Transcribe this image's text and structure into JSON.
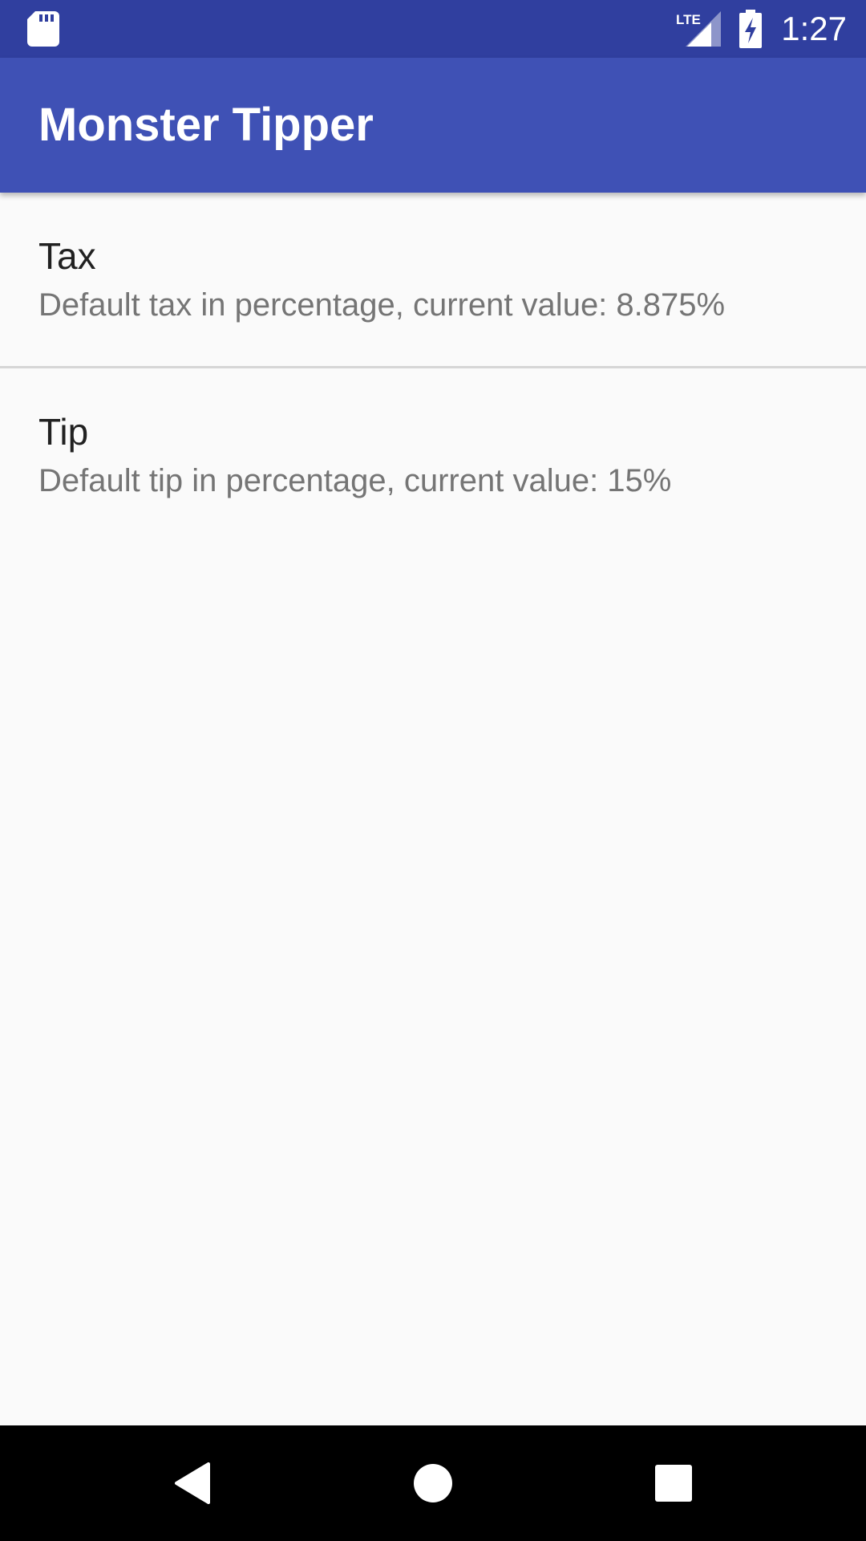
{
  "status_bar": {
    "time": "1:27",
    "network_label": "LTE",
    "icons": [
      "sd-card-icon",
      "lte-signal-icon",
      "battery-charging-icon"
    ]
  },
  "app_bar": {
    "title": "Monster Tipper"
  },
  "preferences": [
    {
      "title": "Tax",
      "summary": "Default tax in percentage, current value: 8.875%"
    },
    {
      "title": "Tip",
      "summary": "Default tip in percentage, current value: 15%"
    }
  ],
  "nav_bar": {
    "icons": [
      "back-icon",
      "home-icon",
      "recents-icon"
    ]
  },
  "colors": {
    "status_bar": "#303f9f",
    "app_bar": "#3f51b5",
    "background": "#fafafa",
    "title_text": "#212121",
    "summary_text": "#757575",
    "divider": "#d6d6d6",
    "nav_bar": "#000000"
  }
}
